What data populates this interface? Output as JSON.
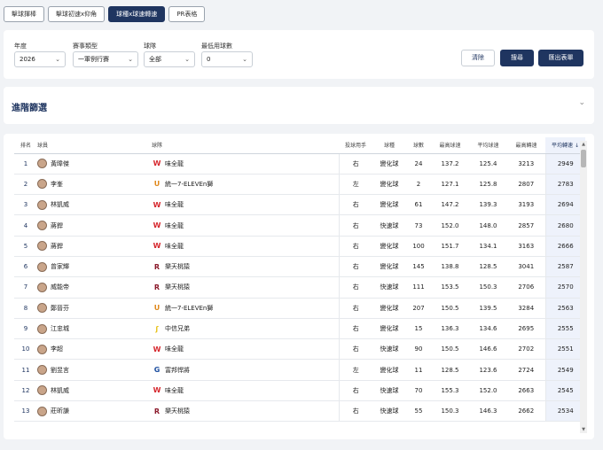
{
  "tabs": [
    "擊球揮棒",
    "擊球初速x仰角",
    "球種x球速轉速",
    "PR表格"
  ],
  "filters": {
    "year_label": "年度",
    "year_value": "2026",
    "type_label": "賽事類型",
    "type_value": "一軍例行賽",
    "team_label": "球隊",
    "team_value": "全部",
    "min_label": "最低用球數",
    "min_value": "0",
    "clear_label": "清除",
    "search_label": "搜尋",
    "export_label": "匯出表單"
  },
  "advanced_title": "進階篩選",
  "table": {
    "headers": [
      "排名",
      "球員",
      "球隊",
      "投球用手",
      "球種",
      "球數",
      "最高球速",
      "平均球速",
      "最高轉速",
      "平均轉速"
    ],
    "sort_indicator": "↓",
    "rows": [
      {
        "rank": "1",
        "player": "黃暐傑",
        "team": "味全龍",
        "team_key": "wei",
        "hand": "右",
        "pitch": "變化球",
        "count": "24",
        "max_v": "137.2",
        "avg_v": "125.4",
        "max_s": "3213",
        "avg_s": "2949"
      },
      {
        "rank": "2",
        "player": "李峯",
        "team": "統一7-ELEVEn獅",
        "team_key": "uni",
        "hand": "左",
        "pitch": "變化球",
        "count": "2",
        "max_v": "127.1",
        "avg_v": "125.8",
        "max_s": "2807",
        "avg_s": "2783"
      },
      {
        "rank": "3",
        "player": "林凱威",
        "team": "味全龍",
        "team_key": "wei",
        "hand": "右",
        "pitch": "變化球",
        "count": "61",
        "max_v": "147.2",
        "avg_v": "139.3",
        "max_s": "3193",
        "avg_s": "2694"
      },
      {
        "rank": "4",
        "player": "蔣銲",
        "team": "味全龍",
        "team_key": "wei",
        "hand": "右",
        "pitch": "快速球",
        "count": "73",
        "max_v": "152.0",
        "avg_v": "148.0",
        "max_s": "2857",
        "avg_s": "2680"
      },
      {
        "rank": "5",
        "player": "蔣銲",
        "team": "味全龍",
        "team_key": "wei",
        "hand": "右",
        "pitch": "變化球",
        "count": "100",
        "max_v": "151.7",
        "avg_v": "134.1",
        "max_s": "3163",
        "avg_s": "2666"
      },
      {
        "rank": "6",
        "player": "曾家輝",
        "team": "樂天桃猿",
        "team_key": "rak",
        "hand": "右",
        "pitch": "變化球",
        "count": "145",
        "max_v": "138.8",
        "avg_v": "128.5",
        "max_s": "3041",
        "avg_s": "2587"
      },
      {
        "rank": "7",
        "player": "威能帝",
        "team": "樂天桃猿",
        "team_key": "rak",
        "hand": "右",
        "pitch": "快速球",
        "count": "111",
        "max_v": "153.5",
        "avg_v": "150.3",
        "max_s": "2706",
        "avg_s": "2570"
      },
      {
        "rank": "8",
        "player": "鄭晉芬",
        "team": "統一7-ELEVEn獅",
        "team_key": "uni",
        "hand": "右",
        "pitch": "變化球",
        "count": "207",
        "max_v": "150.5",
        "avg_v": "139.5",
        "max_s": "3284",
        "avg_s": "2563"
      },
      {
        "rank": "9",
        "player": "江忠城",
        "team": "中信兄弟",
        "team_key": "ctb",
        "hand": "右",
        "pitch": "變化球",
        "count": "15",
        "max_v": "136.3",
        "avg_v": "134.6",
        "max_s": "2695",
        "avg_s": "2555"
      },
      {
        "rank": "10",
        "player": "李超",
        "team": "味全龍",
        "team_key": "wei",
        "hand": "右",
        "pitch": "快速球",
        "count": "90",
        "max_v": "150.5",
        "avg_v": "146.6",
        "max_s": "2702",
        "avg_s": "2551"
      },
      {
        "rank": "11",
        "player": "劉昱言",
        "team": "富邦悍將",
        "team_key": "fub",
        "hand": "左",
        "pitch": "變化球",
        "count": "11",
        "max_v": "128.5",
        "avg_v": "123.6",
        "max_s": "2724",
        "avg_s": "2549"
      },
      {
        "rank": "12",
        "player": "林凱威",
        "team": "味全龍",
        "team_key": "wei",
        "hand": "右",
        "pitch": "快速球",
        "count": "70",
        "max_v": "155.3",
        "avg_v": "152.0",
        "max_s": "2663",
        "avg_s": "2545"
      },
      {
        "rank": "13",
        "player": "莊昕謙",
        "team": "樂天桃猿",
        "team_key": "rak",
        "hand": "右",
        "pitch": "快速球",
        "count": "55",
        "max_v": "150.3",
        "avg_v": "146.3",
        "max_s": "2662",
        "avg_s": "2534"
      }
    ]
  },
  "team_logos": {
    "wei": {
      "glyph": "W",
      "color": "#d6282e"
    },
    "uni": {
      "glyph": "U",
      "color": "#e08a1e"
    },
    "rak": {
      "glyph": "R",
      "color": "#8b1a2b"
    },
    "ctb": {
      "glyph": "ʃ",
      "color": "#e8c21a"
    },
    "fub": {
      "glyph": "G",
      "color": "#1e4fa0"
    }
  }
}
